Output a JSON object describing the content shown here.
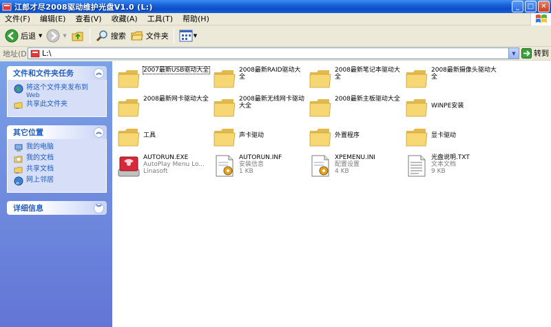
{
  "window": {
    "title": "江郎才尽2008驱动维护光盘V1.0 (L:)",
    "buttons": {
      "minimize": "_",
      "maximize": "□",
      "close": "✕"
    }
  },
  "menu": [
    "文件(F)",
    "编辑(E)",
    "查看(V)",
    "收藏(A)",
    "工具(T)",
    "帮助(H)"
  ],
  "toolbar": {
    "back": "后退",
    "search": "搜索",
    "folders": "文件夹"
  },
  "address": {
    "label": "地址(D)",
    "value": "L:\\",
    "go": "转到"
  },
  "tasks_panel": {
    "title": "文件和文件夹任务",
    "items": [
      {
        "label": "将这个文件夹发布到",
        "label2": "Web"
      },
      {
        "label": "共享此文件夹"
      }
    ]
  },
  "places_panel": {
    "title": "其它位置",
    "items": [
      "我的电脑",
      "我的文档",
      "共享文档",
      "网上邻居"
    ]
  },
  "details_panel": {
    "title": "详细信息"
  },
  "folders": [
    {
      "name": "2007最新USB驱动大全",
      "selected": true
    },
    {
      "name": "2008最新RAID驱动大全"
    },
    {
      "name": "2008最新笔记本驱动大全"
    },
    {
      "name": "2008最新摄像头驱动大全"
    },
    {
      "name": "2008最新网卡驱动大全"
    },
    {
      "name": "2008最新无线网卡驱动大全"
    },
    {
      "name": "2008最新主板驱动大全"
    },
    {
      "name": "WINPE安装"
    },
    {
      "name": "工具"
    },
    {
      "name": "声卡驱动"
    },
    {
      "name": "外置程序"
    },
    {
      "name": "显卡驱动"
    }
  ],
  "files": [
    {
      "name": "AUTORUN.EXE",
      "line2": "AutoPlay Menu Lo...",
      "line3": "Linasoft",
      "icon": "autorun-exe-icon"
    },
    {
      "name": "AUTORUN.INF",
      "line2": "安装信息",
      "line3": "1 KB",
      "icon": "inf-file-icon"
    },
    {
      "name": "XPEMENU.INI",
      "line2": "配置设置",
      "line3": "4 KB",
      "icon": "ini-file-icon"
    },
    {
      "name": "光盘说明.TXT",
      "line2": "文本文档",
      "line3": "9 KB",
      "icon": "txt-file-icon"
    }
  ],
  "colors": {
    "title_bar": "#0a4ec8",
    "left_pane": "#6f8fe0",
    "link": "#215dc6",
    "folder": "#f7d774"
  }
}
